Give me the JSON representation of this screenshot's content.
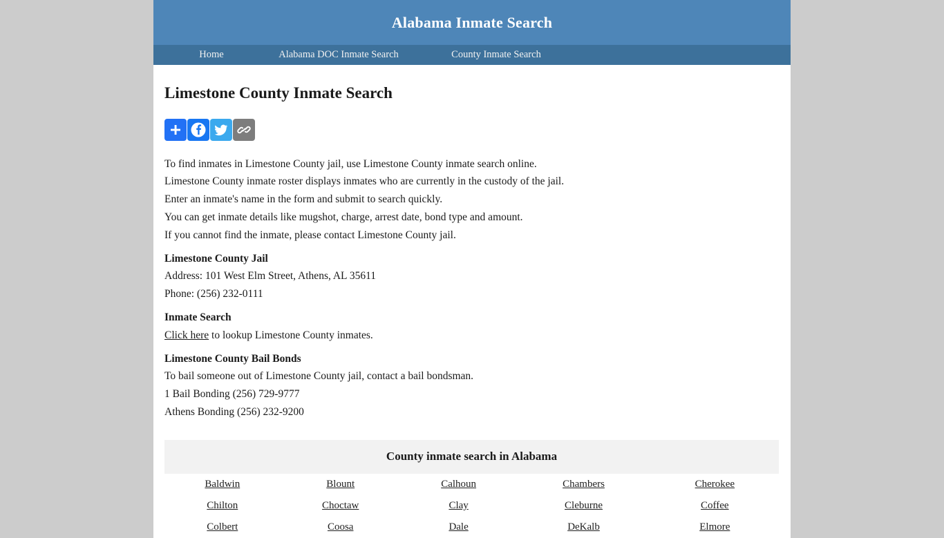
{
  "header": {
    "site_title": "Alabama Inmate Search",
    "brand_color": "#4e86b8",
    "nav_color": "#3d719b"
  },
  "nav": {
    "items": [
      {
        "label": "Home"
      },
      {
        "label": "Alabama DOC Inmate Search"
      },
      {
        "label": "County Inmate Search"
      }
    ]
  },
  "main": {
    "page_title": "Limestone County Inmate Search",
    "share": {
      "buttons": [
        {
          "icon": "plus-icon",
          "label": "Share",
          "color": "#2271f5"
        },
        {
          "icon": "facebook-icon",
          "label": "Facebook",
          "color": "#1877f2"
        },
        {
          "icon": "twitter-icon",
          "label": "Twitter",
          "color": "#3ba9ee"
        },
        {
          "icon": "link-icon",
          "label": "Copy Link",
          "color": "#7d7d7d"
        }
      ]
    },
    "intro_lines": [
      "To find inmates in Limestone County jail, use Limestone County inmate search online.",
      "Limestone County inmate roster displays inmates who are currently in the custody of the jail.",
      "Enter an inmate's name in the form and submit to search quickly.",
      "You can get inmate details like mugshot, charge, arrest date, bond type and amount.",
      "If you cannot find the inmate, please contact Limestone County jail."
    ],
    "jail": {
      "heading": "Limestone County Jail",
      "address": "Address: 101 West Elm Street, Athens, AL 35611",
      "phone": "Phone: (256) 232-0111"
    },
    "inmate_search": {
      "heading": "Inmate Search",
      "link_label": "Click here",
      "link_suffix": " to lookup Limestone County inmates."
    },
    "bail_bonds": {
      "heading": "Limestone County Bail Bonds",
      "intro": "To bail someone out of Limestone County jail, contact a bail bondsman.",
      "bondsmen": [
        "1 Bail Bonding (256) 729-9777",
        "Athens Bonding (256) 232-9200"
      ]
    },
    "county_table": {
      "caption": "County inmate search in Alabama",
      "rows": [
        [
          "Baldwin",
          "Blount",
          "Calhoun",
          "Chambers",
          "Cherokee"
        ],
        [
          "Chilton",
          "Choctaw",
          "Clay",
          "Cleburne",
          "Coffee"
        ],
        [
          "Colbert",
          "Coosa",
          "Dale",
          "DeKalb",
          "Elmore"
        ]
      ]
    }
  }
}
